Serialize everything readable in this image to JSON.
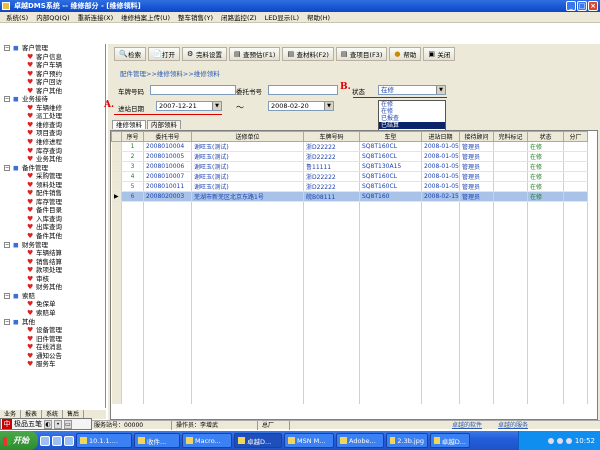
{
  "window": {
    "title": "卓越DMS系统 -- 维修部分 - [维修领料]"
  },
  "menubar": [
    "系统(S)",
    "内部QQ(Q)",
    "重新连接(X)",
    "维修档案上传(U)",
    "整车销售(Y)",
    "闭路监控(Z)",
    "LED显示(L)",
    "帮助(H)"
  ],
  "toolbar": {
    "buttons": [
      {
        "label": "检索",
        "icon": "search-icon"
      },
      {
        "label": "打开",
        "icon": "open-icon"
      },
      {
        "label": "完料设置",
        "icon": "settings-icon"
      },
      {
        "label": "查预估(F1)",
        "icon": "estimate-icon"
      },
      {
        "label": "查材料(F2)",
        "icon": "material-icon"
      },
      {
        "label": "查项目(F3)",
        "icon": "project-icon"
      },
      {
        "label": "帮助",
        "icon": "help-icon"
      },
      {
        "label": "关闭",
        "icon": "close-icon"
      }
    ]
  },
  "breadcrumb": "配件管理>>维修领料>>维修领料",
  "form": {
    "plate_label": "车牌号码",
    "plate_value": "",
    "order_label": "委托书号",
    "order_value": "",
    "state_label": "状态",
    "state_value": "在修",
    "date_label": "进站日期",
    "date_from": "2007-12-21",
    "date_sep": "～",
    "date_to": "2008-02-20",
    "annotation_a": "A.",
    "annotation_b": "B."
  },
  "state_options": [
    "在修",
    "在修",
    "已报查",
    "已结算"
  ],
  "subtabs": [
    "维修领料",
    "内部领料"
  ],
  "table": {
    "headers": [
      "序号",
      "委托书号",
      "送修单位",
      "车牌号码",
      "车型",
      "进站日期",
      "接待顾问",
      "完料标记",
      "状态",
      "分厂"
    ],
    "rows": [
      [
        "1",
        "2008010004",
        "谢旺玉(测试)",
        "浙D22222",
        "SQ8T160CL",
        "2008-01-05",
        "管理员",
        "",
        "在修",
        ""
      ],
      [
        "2",
        "2008010005",
        "谢旺玉(测试)",
        "浙D22222",
        "SQ8T160CL",
        "2008-01-05",
        "管理员",
        "",
        "在修",
        ""
      ],
      [
        "3",
        "2008010006",
        "谢旺玉(测试)",
        "鲁11111",
        "SQ8T130A15",
        "2008-01-05",
        "管理员",
        "",
        "在修",
        ""
      ],
      [
        "4",
        "2008010007",
        "谢旺玉(测试)",
        "浙D22222",
        "SQ8T160CL",
        "2008-01-05",
        "管理员",
        "",
        "在修",
        ""
      ],
      [
        "5",
        "2008010011",
        "谢旺玉(测试)",
        "浙D22222",
        "SQ8T160CL",
        "2008-01-05",
        "管理员",
        "",
        "在修",
        ""
      ],
      [
        "6",
        "2008020003",
        "芜湖市新芜区北京东路1号",
        "皖B08111",
        "SQ8T160",
        "2008-02-15",
        "管理员",
        "",
        "在修",
        ""
      ]
    ]
  },
  "tree": [
    {
      "label": "客户管理",
      "level": 0
    },
    {
      "label": "客户信息",
      "level": 1
    },
    {
      "label": "客户车辆",
      "level": 1
    },
    {
      "label": "客户预约",
      "level": 1
    },
    {
      "label": "客户回访",
      "level": 1
    },
    {
      "label": "客户其他",
      "level": 1
    },
    {
      "label": "业务接待",
      "level": 0
    },
    {
      "label": "车辆维修",
      "level": 1
    },
    {
      "label": "派工处理",
      "level": 1
    },
    {
      "label": "维修查询",
      "level": 1
    },
    {
      "label": "项目查询",
      "level": 1
    },
    {
      "label": "维修进程",
      "level": 1
    },
    {
      "label": "库存查询",
      "level": 1
    },
    {
      "label": "业务其他",
      "level": 1
    },
    {
      "label": "备件管理",
      "level": 0
    },
    {
      "label": "采购管理",
      "level": 1
    },
    {
      "label": "领料处理",
      "level": 1
    },
    {
      "label": "配件销售",
      "level": 1
    },
    {
      "label": "库存管理",
      "level": 1
    },
    {
      "label": "备件目录",
      "level": 1
    },
    {
      "label": "入库查询",
      "level": 1
    },
    {
      "label": "出库查询",
      "level": 1
    },
    {
      "label": "备件其他",
      "level": 1
    },
    {
      "label": "财务管理",
      "level": 0
    },
    {
      "label": "车辆结算",
      "level": 1
    },
    {
      "label": "销售结算",
      "level": 1
    },
    {
      "label": "款项处理",
      "level": 1
    },
    {
      "label": "审核",
      "level": 1
    },
    {
      "label": "财务其他",
      "level": 1
    },
    {
      "label": "索赔",
      "level": 0
    },
    {
      "label": "免保单",
      "level": 1
    },
    {
      "label": "索赔单",
      "level": 1
    },
    {
      "label": "其他",
      "level": 0
    },
    {
      "label": "设备管理",
      "level": 1
    },
    {
      "label": "旧件管理",
      "level": 1
    },
    {
      "label": "在线消息",
      "level": 1
    },
    {
      "label": "通知公告",
      "level": 1
    },
    {
      "label": "服务车",
      "level": 1
    }
  ],
  "left_tabs": [
    "业务",
    "报表",
    "系统",
    "售后"
  ],
  "ime": {
    "badge": "中",
    "name": "极品五笔"
  },
  "statusbar": {
    "station": "服务站号：00000",
    "operator": "操作员：李增武",
    "section": "总厂",
    "link1": "卓越的软件",
    "link2": "卓越的服务"
  },
  "taskbar": {
    "start": "开始",
    "tasks": [
      "10.1.1....",
      "收件...",
      "Macro...",
      "卓越D...",
      "MSN M...",
      "Adobe...",
      "2.3b.jpg",
      "卓越D..."
    ],
    "clock": "10:52"
  }
}
